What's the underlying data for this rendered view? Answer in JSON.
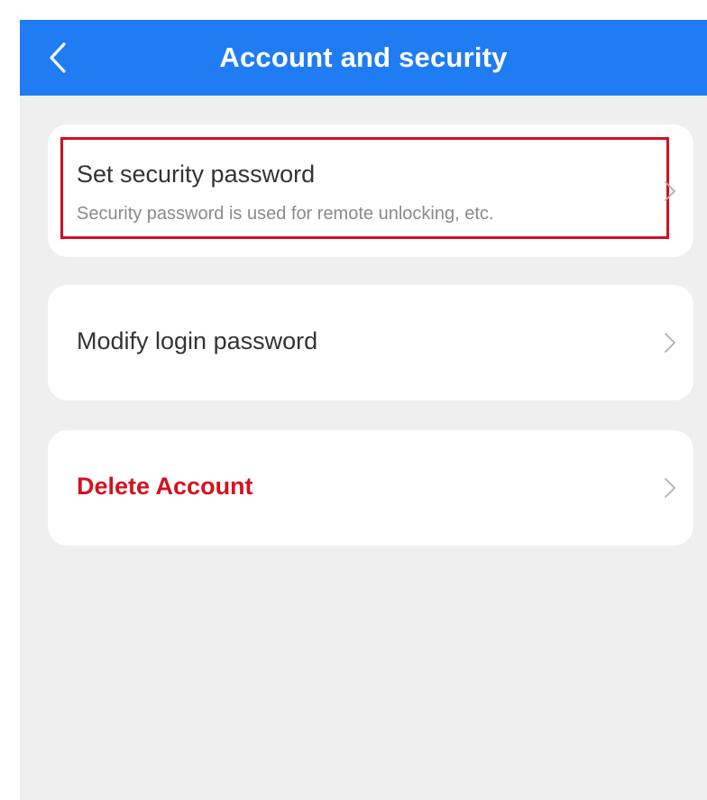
{
  "header": {
    "title": "Account and security",
    "back_icon": "chevron-left-icon",
    "background_color": "#1f7cf3"
  },
  "items": [
    {
      "title": "Set security password",
      "subtitle": "Security password is used for remote unlocking, etc.",
      "highlighted": true,
      "highlight_color": "#d20f24"
    },
    {
      "title": "Modify login password"
    },
    {
      "title": "Delete Account",
      "title_color": "#d4121f"
    }
  ],
  "colors": {
    "page_background": "#efefef",
    "card_background": "#ffffff",
    "chevron": "#b0b0b0"
  }
}
